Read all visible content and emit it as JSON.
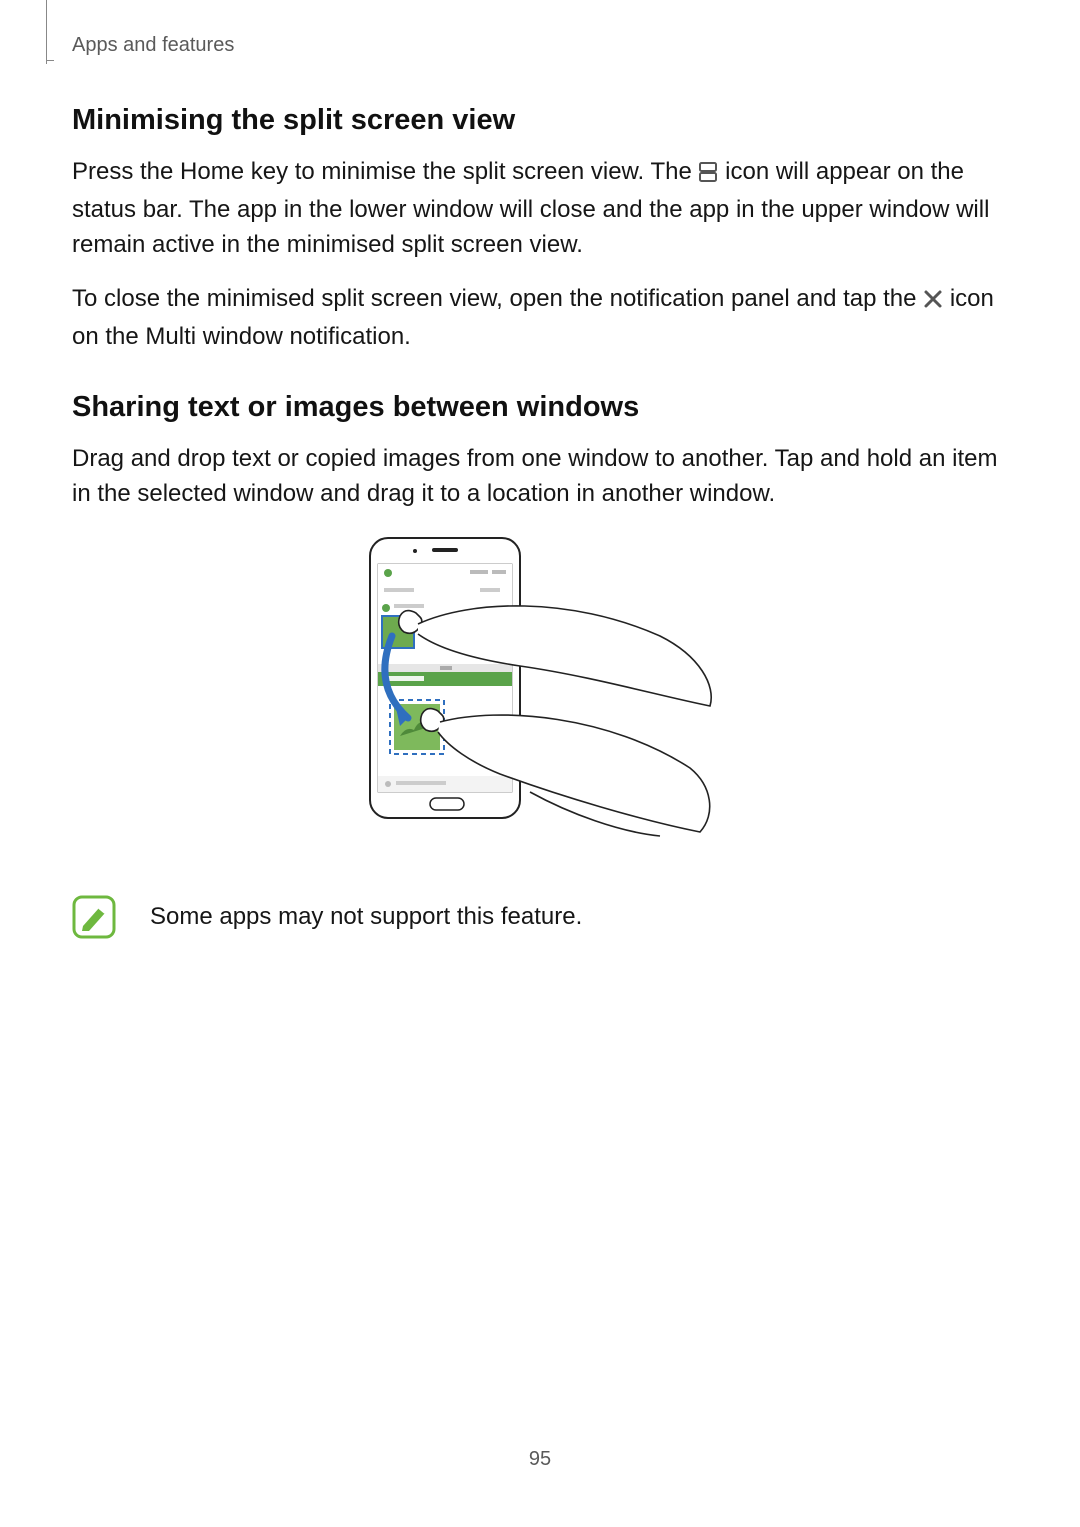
{
  "header": {
    "breadcrumb": "Apps and features"
  },
  "section1": {
    "heading": "Minimising the split screen view",
    "para1_a": "Press the Home key to minimise the split screen view. The ",
    "para1_b": " icon will appear on the status bar. The app in the lower window will close and the app in the upper window will remain active in the minimised split screen view.",
    "para2_a": "To close the minimised split screen view, open the notification panel and tap the ",
    "para2_b": " icon on the Multi window notification."
  },
  "section2": {
    "heading": "Sharing text or images between windows",
    "para1": "Drag and drop text or copied images from one window to another. Tap and hold an item in the selected window and drag it to a location in another window."
  },
  "note": {
    "text": "Some apps may not support this feature."
  },
  "page_number": "95"
}
